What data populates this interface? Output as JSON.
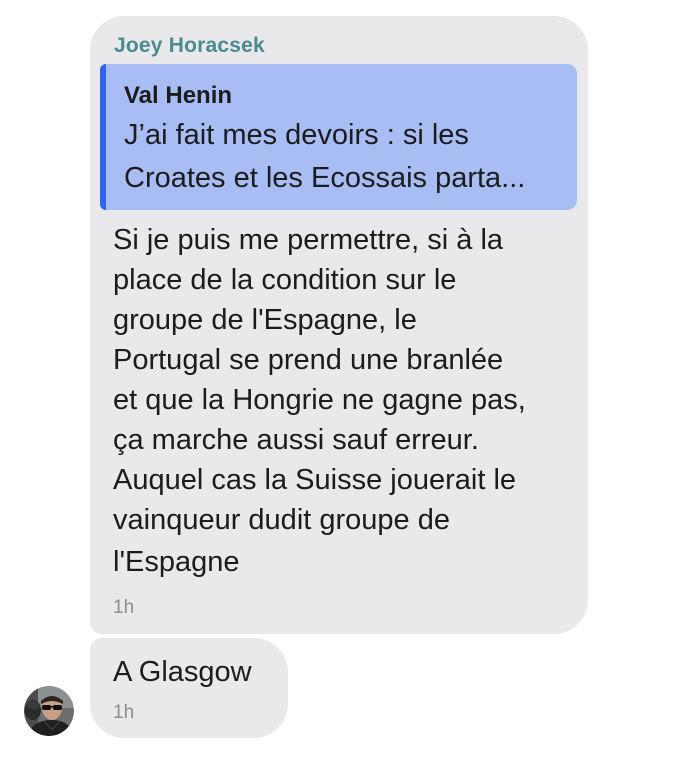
{
  "message": {
    "sender": "Joey Horacsek",
    "quote": {
      "author": "Val Henin",
      "lines": [
        "J’ai fait mes devoirs : si les",
        "Croates et les Ecossais parta..."
      ]
    },
    "lines": [
      "Si je puis me permettre, si à la",
      "place de la condition sur le",
      "groupe de l'Espagne, le",
      "Portugal se prend une branlée",
      "et que la Hongrie ne gagne pas,",
      "ça marche aussi sauf erreur.",
      "Auquel cas la Suisse jouerait le",
      "vainqueur dudit groupe de",
      "l'Espagne"
    ],
    "time": "1h"
  },
  "second_message": {
    "text": "A Glasgow",
    "time": "1h"
  },
  "colors": {
    "bubble": "#e9e9eb",
    "quote_background": "#a7bdf4",
    "quote_bar": "#2f63e9",
    "sender_name": "#4a8a90",
    "timestamp": "#8e8e93"
  }
}
